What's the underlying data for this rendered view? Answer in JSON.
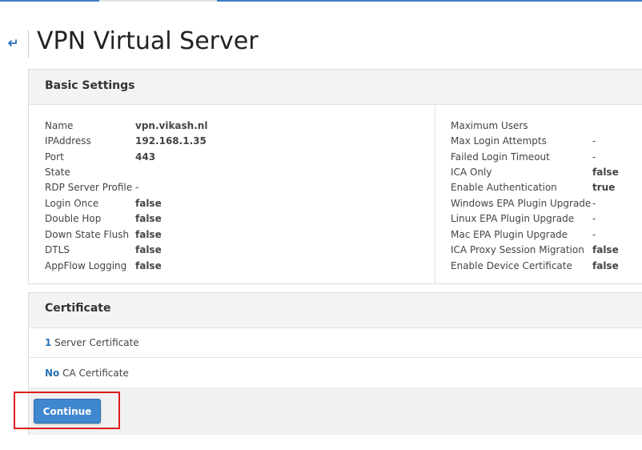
{
  "header": {
    "back_icon": "back-arrow-icon",
    "title": "VPN Virtual Server"
  },
  "basic_settings": {
    "title": "Basic Settings",
    "left": [
      {
        "label": "Name",
        "value": "vpn.vikash.nl"
      },
      {
        "label": "IPAddress",
        "value": "192.168.1.35"
      },
      {
        "label": "Port",
        "value": "443"
      },
      {
        "label": "State",
        "value": ""
      },
      {
        "label": "RDP Server Profile",
        "value": "-"
      },
      {
        "label": "Login Once",
        "value": "false"
      },
      {
        "label": "Double Hop",
        "value": "false"
      },
      {
        "label": "Down State Flush",
        "value": "false"
      },
      {
        "label": "DTLS",
        "value": "false"
      },
      {
        "label": "AppFlow Logging",
        "value": "false"
      }
    ],
    "right": [
      {
        "label": "Maximum Users",
        "value": ""
      },
      {
        "label": "Max Login Attempts",
        "value": "-"
      },
      {
        "label": "Failed Login Timeout",
        "value": "-"
      },
      {
        "label": "ICA Only",
        "value": "false"
      },
      {
        "label": "Enable Authentication",
        "value": "true"
      },
      {
        "label": "Windows EPA Plugin Upgrade",
        "value": "-"
      },
      {
        "label": "Linux EPA Plugin Upgrade",
        "value": "-"
      },
      {
        "label": "Mac EPA Plugin Upgrade",
        "value": "-"
      },
      {
        "label": "ICA Proxy Session Migration",
        "value": "false"
      },
      {
        "label": "Enable Device Certificate",
        "value": "false"
      }
    ]
  },
  "certificate": {
    "title": "Certificate",
    "server": {
      "count": "1",
      "label": " Server Certificate"
    },
    "ca": {
      "count": "No",
      "label": " CA Certificate"
    }
  },
  "actions": {
    "continue_label": "Continue"
  },
  "colors": {
    "accent": "#3f87cf",
    "link": "#2a72b5",
    "highlight": "#e01b1b"
  }
}
